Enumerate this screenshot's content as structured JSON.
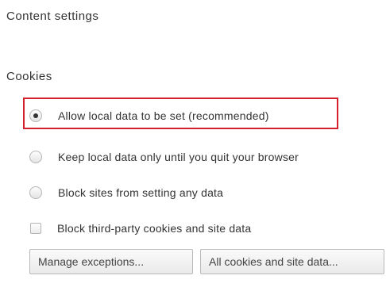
{
  "header": {
    "title": "Content settings"
  },
  "cookies": {
    "section_title": "Cookies",
    "options": [
      {
        "label": "Allow local data to be set (recommended)",
        "type": "radio",
        "checked": true
      },
      {
        "label": "Keep local data only until you quit your browser",
        "type": "radio",
        "checked": false
      },
      {
        "label": "Block sites from setting any data",
        "type": "radio",
        "checked": false
      },
      {
        "label": "Block third-party cookies and site data",
        "type": "checkbox",
        "checked": false
      }
    ],
    "buttons": {
      "manage_exceptions": "Manage exceptions...",
      "all_cookies": "All cookies and site data..."
    }
  },
  "colors": {
    "highlight": "#d7202e"
  }
}
